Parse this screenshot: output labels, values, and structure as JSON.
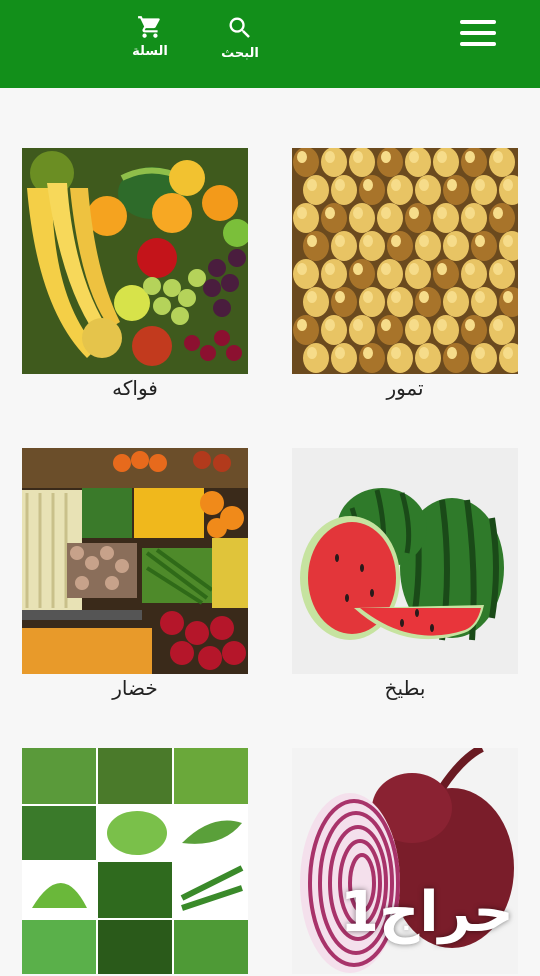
{
  "topbar": {
    "cart_label": "السلة",
    "search_label": "البحث",
    "cart_icon": "cart-icon",
    "search_icon": "search-icon",
    "menu_icon": "hamburger-menu-icon",
    "bg_color": "#128f1a"
  },
  "categories": [
    {
      "label": "تمور",
      "image": "dates-image"
    },
    {
      "label": "فواكه",
      "image": "fruits-image"
    },
    {
      "label": "بطيخ",
      "image": "watermelon-image"
    },
    {
      "label": "خضار",
      "image": "vegetables-image"
    },
    {
      "label": "",
      "image": "onion-image"
    },
    {
      "label": "",
      "image": "leafy-greens-image"
    }
  ],
  "watermark": "حراج1"
}
